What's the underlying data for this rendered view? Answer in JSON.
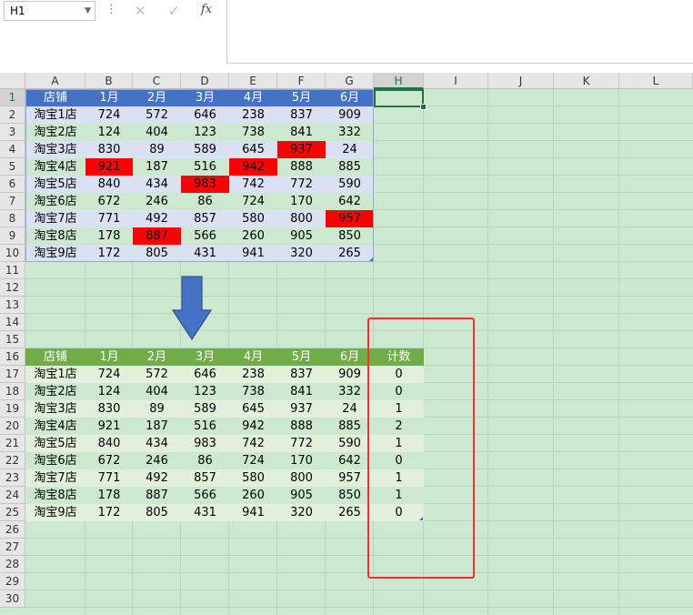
{
  "formula_bar": {
    "name_box": "H1",
    "cancel_icon": "✕",
    "enter_icon": "✓",
    "fx_label": "fx",
    "formula": ""
  },
  "columns": [
    "A",
    "B",
    "C",
    "D",
    "E",
    "F",
    "G",
    "H",
    "I",
    "J",
    "K",
    "L"
  ],
  "selected_column": "H",
  "selected_row": 1,
  "rows": [
    "1",
    "2",
    "3",
    "4",
    "5",
    "6",
    "7",
    "8",
    "9",
    "10",
    "11",
    "12",
    "13",
    "14",
    "15",
    "16",
    "17",
    "18",
    "19",
    "20",
    "21",
    "22",
    "23",
    "24",
    "25",
    "26",
    "27",
    "28",
    "29",
    "30"
  ],
  "colors": {
    "table1_header": "#4472c4",
    "table1_band_odd": "#d9e1f2",
    "table1_band_even": "#cce8cf",
    "table2_header": "#70ad47",
    "table2_band_odd": "#e2efda",
    "table2_band_even": "#cce8cf",
    "highlight": "#ff0000",
    "arrow": "#4472c4",
    "annotation_box": "#ff2a2a"
  },
  "table1": {
    "headers": [
      "店铺",
      "1月",
      "2月",
      "3月",
      "4月",
      "5月",
      "6月"
    ],
    "rows": [
      [
        "淘宝1店",
        "724",
        "572",
        "646",
        "238",
        "837",
        "909"
      ],
      [
        "淘宝2店",
        "124",
        "404",
        "123",
        "738",
        "841",
        "332"
      ],
      [
        "淘宝3店",
        "830",
        "89",
        "589",
        "645",
        "937",
        "24"
      ],
      [
        "淘宝4店",
        "921",
        "187",
        "516",
        "942",
        "888",
        "885"
      ],
      [
        "淘宝5店",
        "840",
        "434",
        "983",
        "742",
        "772",
        "590"
      ],
      [
        "淘宝6店",
        "672",
        "246",
        "86",
        "724",
        "170",
        "642"
      ],
      [
        "淘宝7店",
        "771",
        "492",
        "857",
        "580",
        "800",
        "957"
      ],
      [
        "淘宝8店",
        "178",
        "887",
        "566",
        "260",
        "905",
        "850"
      ],
      [
        "淘宝9店",
        "172",
        "805",
        "431",
        "941",
        "320",
        "265"
      ]
    ],
    "highlights": [
      [
        2,
        5
      ],
      [
        3,
        1
      ],
      [
        3,
        4
      ],
      [
        4,
        3
      ],
      [
        6,
        6
      ],
      [
        7,
        2
      ]
    ]
  },
  "table2": {
    "headers": [
      "店铺",
      "1月",
      "2月",
      "3月",
      "4月",
      "5月",
      "6月",
      "计数"
    ],
    "rows": [
      [
        "淘宝1店",
        "724",
        "572",
        "646",
        "238",
        "837",
        "909",
        "0"
      ],
      [
        "淘宝2店",
        "124",
        "404",
        "123",
        "738",
        "841",
        "332",
        "0"
      ],
      [
        "淘宝3店",
        "830",
        "89",
        "589",
        "645",
        "937",
        "24",
        "1"
      ],
      [
        "淘宝4店",
        "921",
        "187",
        "516",
        "942",
        "888",
        "885",
        "2"
      ],
      [
        "淘宝5店",
        "840",
        "434",
        "983",
        "742",
        "772",
        "590",
        "1"
      ],
      [
        "淘宝6店",
        "672",
        "246",
        "86",
        "724",
        "170",
        "642",
        "0"
      ],
      [
        "淘宝7店",
        "771",
        "492",
        "857",
        "580",
        "800",
        "957",
        "1"
      ],
      [
        "淘宝8店",
        "178",
        "887",
        "566",
        "260",
        "905",
        "850",
        "1"
      ],
      [
        "淘宝9店",
        "172",
        "805",
        "431",
        "941",
        "320",
        "265",
        "0"
      ]
    ]
  }
}
